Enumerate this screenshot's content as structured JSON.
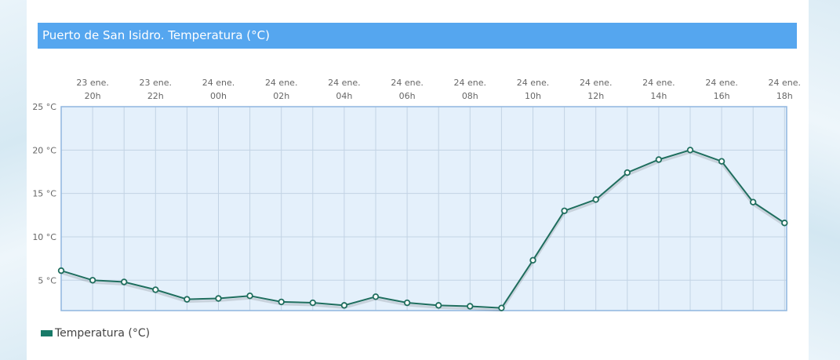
{
  "title": "Puerto de San Isidro. Temperatura (°C)",
  "legend": {
    "label": "Temperatura (°C)"
  },
  "colors": {
    "title_bar": "#55a6ef",
    "plot_background": "#e4f0fb",
    "plot_border": "#8fb6df",
    "series_line": "#1f6e5e",
    "marker_fill": "#ffffff",
    "legend_swatch": "#187a68"
  },
  "chart_data": {
    "type": "line",
    "title": "Puerto de San Isidro. Temperatura (°C)",
    "xlabel": "",
    "ylabel": "",
    "y_ticks": [
      {
        "value": 25,
        "label": "25 °C"
      },
      {
        "value": 20,
        "label": "20 °C"
      },
      {
        "value": 15,
        "label": "15 °C"
      },
      {
        "value": 10,
        "label": "10 °C"
      },
      {
        "value": 5,
        "label": "5 °C"
      }
    ],
    "ylim": [
      1.5,
      25
    ],
    "x_tick_labels": [
      {
        "line1": "23 ene.",
        "line2": "20h"
      },
      {
        "line1": "23 ene.",
        "line2": "22h"
      },
      {
        "line1": "24 ene.",
        "line2": "00h"
      },
      {
        "line1": "24 ene.",
        "line2": "02h"
      },
      {
        "line1": "24 ene.",
        "line2": "04h"
      },
      {
        "line1": "24 ene.",
        "line2": "06h"
      },
      {
        "line1": "24 ene.",
        "line2": "08h"
      },
      {
        "line1": "24 ene.",
        "line2": "10h"
      },
      {
        "line1": "24 ene.",
        "line2": "12h"
      },
      {
        "line1": "24 ene.",
        "line2": "14h"
      },
      {
        "line1": "24 ene.",
        "line2": "16h"
      },
      {
        "line1": "24 ene.",
        "line2": "18h"
      }
    ],
    "x": [
      "23 ene. 19h",
      "23 ene. 20h",
      "23 ene. 21h",
      "23 ene. 22h",
      "23 ene. 23h",
      "24 ene. 00h",
      "24 ene. 01h",
      "24 ene. 02h",
      "24 ene. 03h",
      "24 ene. 04h",
      "24 ene. 05h",
      "24 ene. 06h",
      "24 ene. 07h",
      "24 ene. 08h",
      "24 ene. 09h",
      "24 ene. 10h",
      "24 ene. 11h",
      "24 ene. 12h",
      "24 ene. 13h",
      "24 ene. 14h",
      "24 ene. 15h",
      "24 ene. 16h",
      "24 ene. 17h",
      "24 ene. 18h",
      "24 ene. 19h"
    ],
    "series": [
      {
        "name": "Temperatura (°C)",
        "values": [
          6.1,
          5.0,
          4.8,
          3.9,
          2.8,
          2.9,
          3.2,
          2.5,
          2.4,
          2.1,
          3.1,
          2.4,
          2.1,
          2.0,
          1.8,
          7.3,
          13.0,
          14.3,
          17.4,
          18.9,
          20.0,
          18.7,
          14.0,
          11.6,
          null
        ],
        "color": "#1f6e5e"
      }
    ],
    "grid": true,
    "legend_position": "bottom-left"
  }
}
